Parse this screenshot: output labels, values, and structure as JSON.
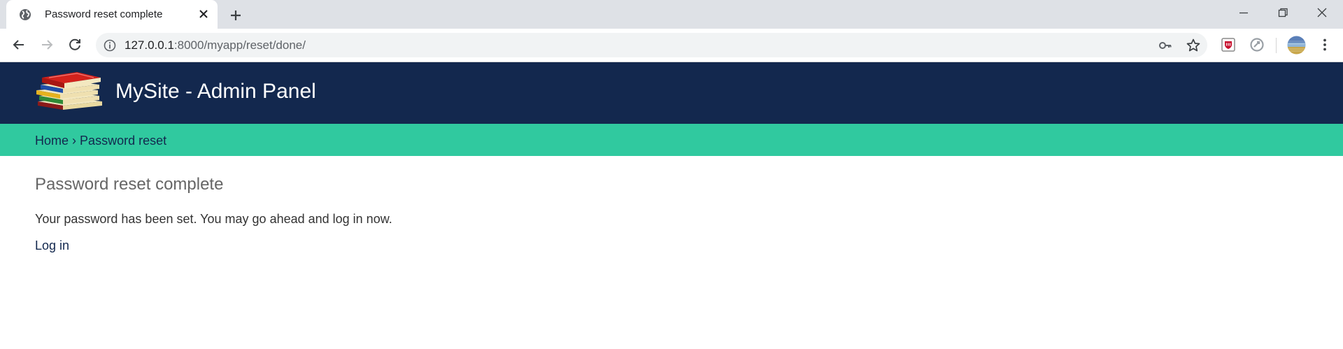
{
  "browser": {
    "tab_title": "Password reset complete",
    "url_host": "127.0.0.1",
    "url_path": ":8000/myapp/reset/done/",
    "icons": {
      "favicon": "globe-icon",
      "tab_close": "close-icon",
      "new_tab": "plus-icon",
      "back": "arrow-left-icon",
      "forward": "arrow-right-icon",
      "reload": "reload-icon",
      "site_info": "info-icon",
      "password": "key-icon",
      "bookmark": "star-icon",
      "menu": "kebab-menu-icon"
    }
  },
  "header": {
    "site_title": "MySite - Admin Panel",
    "logo": "books-logo",
    "background_color": "#13284e"
  },
  "breadcrumb": {
    "home": "Home",
    "separator": "›",
    "current": "Password reset",
    "background_color": "#30c99f"
  },
  "main": {
    "title": "Password reset complete",
    "message": "Your password has been set. You may go ahead and log in now.",
    "login_link": "Log in"
  }
}
